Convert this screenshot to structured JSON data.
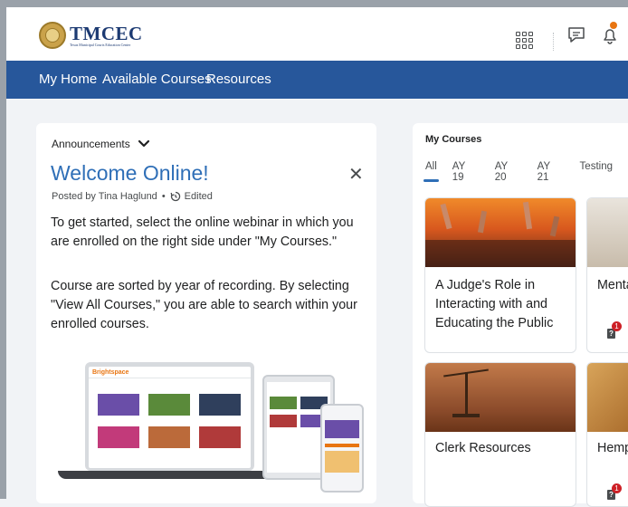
{
  "header": {
    "logo_text": "TMCEC",
    "logo_subtitle": "Texas Municipal Courts Education Center",
    "icons": [
      "grid-icon",
      "chat-icon",
      "bell-icon"
    ]
  },
  "nav": {
    "items": [
      {
        "label": "My Home"
      },
      {
        "label": "Available Courses"
      },
      {
        "label": "Resources"
      }
    ]
  },
  "announcements": {
    "header_label": "Announcements",
    "title": "Welcome Online!",
    "posted_by": "Posted by Tina Haglund",
    "edited_label": "Edited",
    "paragraph1": "To get started, select the online webinar in which you are enrolled on the right side under \"My Courses.\"",
    "paragraph2": "Course are sorted by year of recording. By selecting \"View All Courses,\" you are able to search within your enrolled courses.",
    "devices": {
      "laptop_brand": "Brightspace"
    }
  },
  "my_courses": {
    "label": "My Courses",
    "tabs": [
      "All",
      "AY 19",
      "AY 20",
      "AY 21",
      "Testing"
    ],
    "active_tab": "All",
    "accent_color": "#2f6fb7",
    "tiles": [
      {
        "title": "A Judge's Role in Interacting with and Educating the Public",
        "badge": null
      },
      {
        "title": "Menta",
        "badge": "1"
      },
      {
        "title": "Clerk Resources",
        "badge": null
      },
      {
        "title": "Hemp",
        "badge": "1"
      }
    ]
  }
}
